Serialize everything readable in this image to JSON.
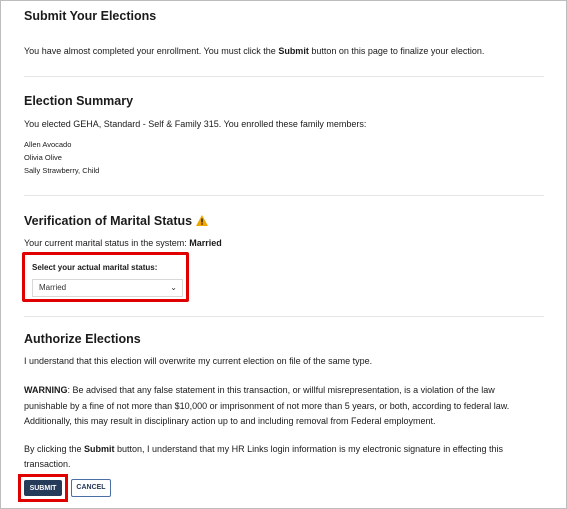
{
  "submit_section": {
    "heading": "Submit Your Elections",
    "text_before": "You have almost completed your enrollment. You must click the ",
    "text_bold": "Submit",
    "text_after": " button on this page to finalize your election."
  },
  "summary_section": {
    "heading": "Election Summary",
    "text": "You elected GEHA, Standard - Self & Family 315. You enrolled these family members:",
    "members": [
      "Allen Avocado",
      "Olivia Olive",
      "Sally Strawberry, Child"
    ]
  },
  "marital_section": {
    "heading": "Verification of Marital Status",
    "warning_icon": "warning-triangle-icon",
    "current_text": "Your current marital status in the system: ",
    "current_value": "Married",
    "select_label": "Select your actual marital status:",
    "select_value": "Married"
  },
  "authorize_section": {
    "heading": "Authorize Elections",
    "overwrite_text": "I understand that this election will overwrite my current election on file of the same type.",
    "warning_label": "WARNING",
    "warning_lines": [
      ":  Be advised that any false statement in this transaction, or willful misrepresentation, is a violation of the law",
      "punishable by a fine of not more than $10,000 or imprisonment of not more than 5 years, or both, according to federal law.",
      "Additionally, this may result in disciplinary action up to and including removal from Federal employment."
    ],
    "signature_before": "By clicking the ",
    "signature_bold": "Submit",
    "signature_after": " button, I understand that my HR Links login information is my electronic signature in effecting this",
    "signature_line2": "transaction."
  },
  "buttons": {
    "submit": "SUBMIT",
    "cancel": "CANCEL"
  },
  "colors": {
    "primary": "#263a59",
    "highlight": "#e00000",
    "warning": "#f0a500"
  }
}
